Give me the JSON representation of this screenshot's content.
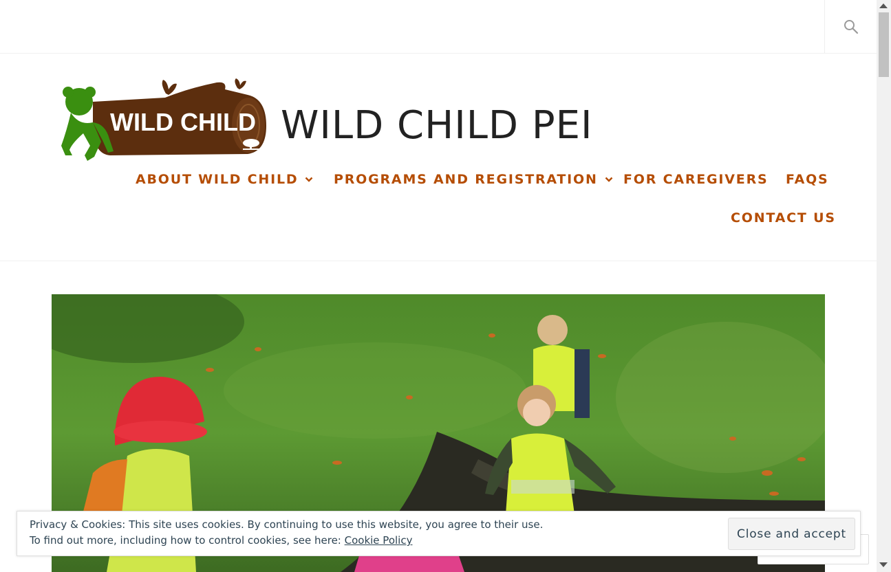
{
  "site": {
    "title": "WILD CHILD PEI",
    "logo_text": "WILD CHILD"
  },
  "colors": {
    "nav": "#b54d04",
    "logo_brown": "#5c2e0e",
    "logo_green": "#3a8f10"
  },
  "nav": {
    "items": [
      {
        "label": "ABOUT WILD CHILD",
        "has_dropdown": true
      },
      {
        "label": "PROGRAMS AND REGISTRATION",
        "has_dropdown": true
      },
      {
        "label": "FOR CAREGIVERS",
        "has_dropdown": false
      },
      {
        "label": "FAQS",
        "has_dropdown": false
      },
      {
        "label": "CONTACT US",
        "has_dropdown": false
      }
    ]
  },
  "cookie": {
    "line1": "Privacy & Cookies: This site uses cookies. By continuing to use this website, you agree to their use.",
    "line2_prefix": "To find out more, including how to control cookies, see here: ",
    "link": "Cookie Policy",
    "button": "Close and accept"
  },
  "icons": [
    "search-icon",
    "chevron-down-icon",
    "butterfly-icon",
    "child-figure-icon",
    "tree-icon"
  ]
}
